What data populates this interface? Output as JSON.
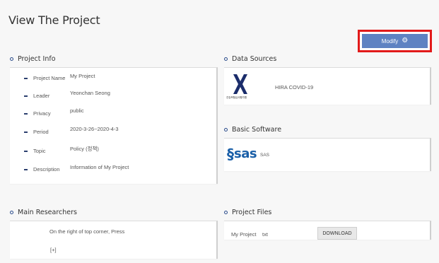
{
  "page": {
    "title": "View The Project"
  },
  "toolbar": {
    "modify_label": "Modify",
    "modify_icon": "gear-icon"
  },
  "project_info": {
    "heading": "Project Info",
    "rows": [
      {
        "label": "Project Name",
        "value": "My Project"
      },
      {
        "label": "Leader",
        "value": "Yeonchan Seong"
      },
      {
        "label": "Privacy",
        "value": "public"
      },
      {
        "label": "Period",
        "value": "2020-3-26~2020-4-3"
      },
      {
        "label": "Topic",
        "value": "Policy (정책)"
      },
      {
        "label": "Description",
        "value": "Information of My Project"
      }
    ]
  },
  "data_sources": {
    "heading": "Data Sources",
    "items": [
      {
        "name": "HIRA COVID-19",
        "logo_text": "건강보험심사평가원"
      }
    ]
  },
  "basic_software": {
    "heading": "Basic Software",
    "items": [
      {
        "logo": "sas",
        "name": "SAS"
      }
    ]
  },
  "main_researchers": {
    "heading": "Main Researchers",
    "hint": "On the right of top corner, Press",
    "add_label": "[+]"
  },
  "project_files": {
    "heading": "Project Files",
    "files": [
      {
        "name": "My Project",
        "ext": "txt",
        "action": "DOWNLOAD"
      }
    ]
  },
  "colors": {
    "accent": "#5e82c2",
    "highlight_border": "#e21a1a",
    "bullet": "#2b4c8c",
    "sas_blue": "#1a5fa8"
  }
}
